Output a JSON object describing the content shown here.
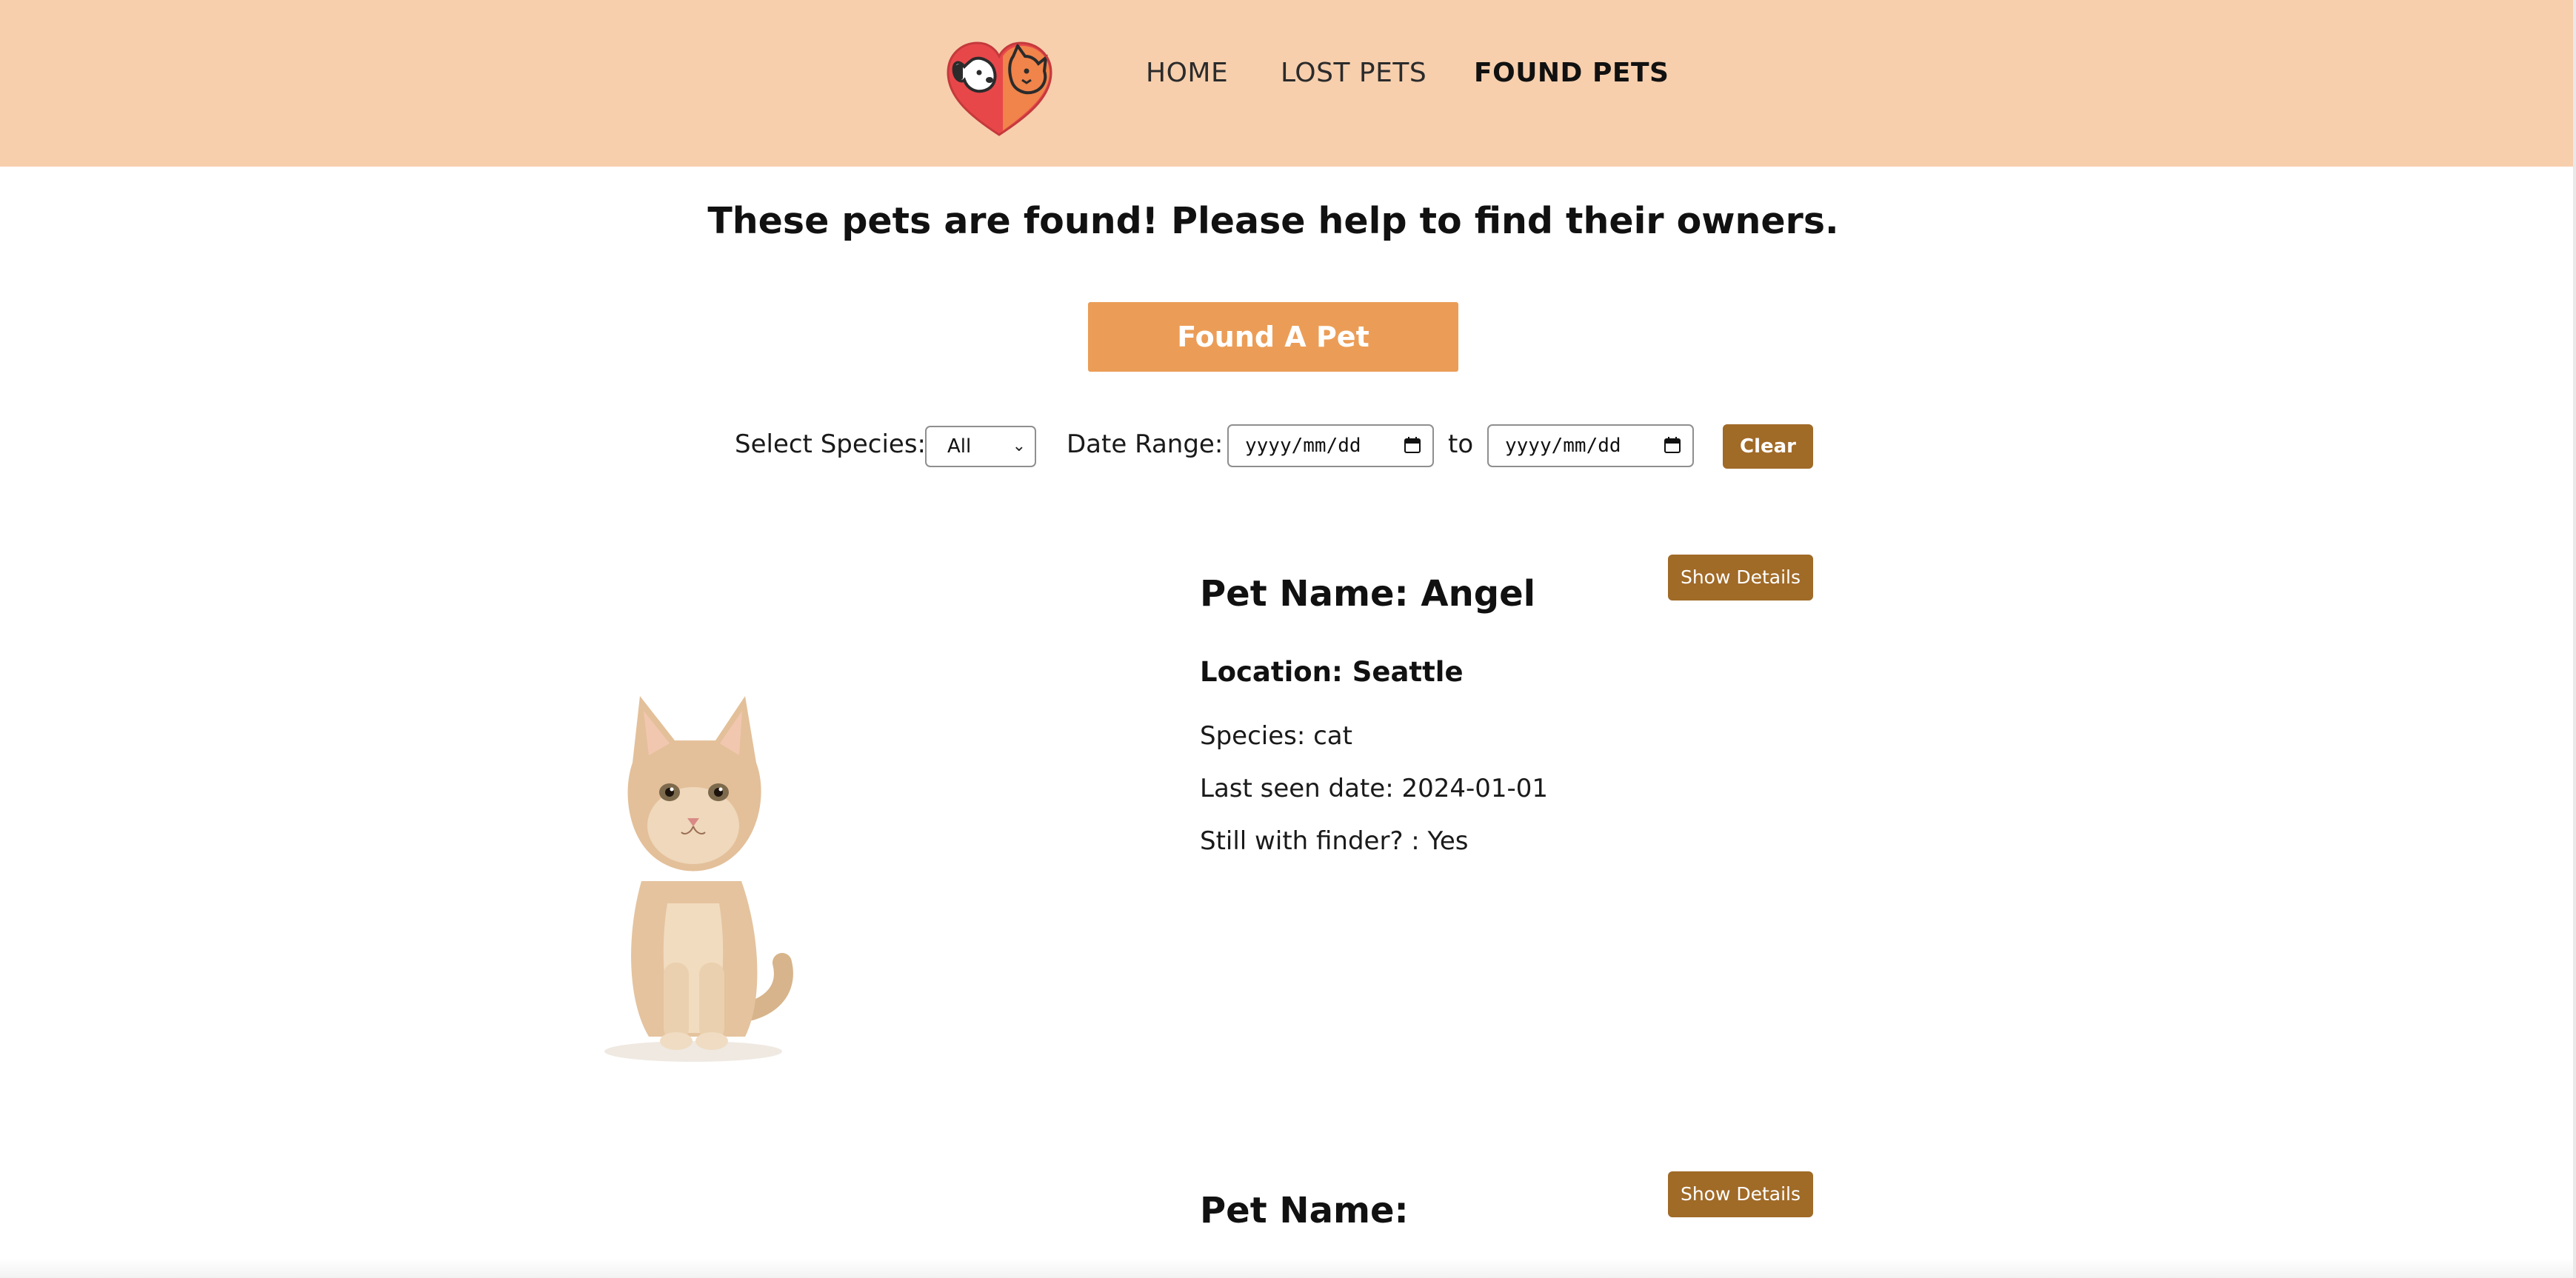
{
  "nav": {
    "home": "HOME",
    "lost": "LOST PETS",
    "found": "FOUND PETS"
  },
  "main": {
    "heading": "These pets are found! Please help to find their owners.",
    "cta_label": "Found A Pet"
  },
  "filters": {
    "species_label": "Select Species:",
    "species_value": "All",
    "date_range_label": "Date Range:",
    "date_from_placeholder": "yyyy/mm/dd",
    "to_label": "to",
    "date_to_placeholder": "yyyy/mm/dd",
    "clear_label": "Clear"
  },
  "pets": [
    {
      "details_label": "Show Details",
      "name": "Pet Name: Angel",
      "location": "Location: Seattle",
      "species": "Species: cat",
      "last_seen": "Last seen date: 2024-01-01",
      "with_finder": "Still with finder? : Yes"
    },
    {
      "details_label": "Show Details",
      "name": "Pet Name:"
    }
  ],
  "colors": {
    "header_bg": "#f7cfad",
    "cta_bg": "#eb9d57",
    "button_brown": "#a06a27",
    "logo_red": "#e8474a",
    "logo_orange": "#f0844a"
  },
  "icons": {
    "logo": "dog-and-cat-heart-logo",
    "calendar": "calendar-icon",
    "chevron": "chevron-down-icon"
  }
}
